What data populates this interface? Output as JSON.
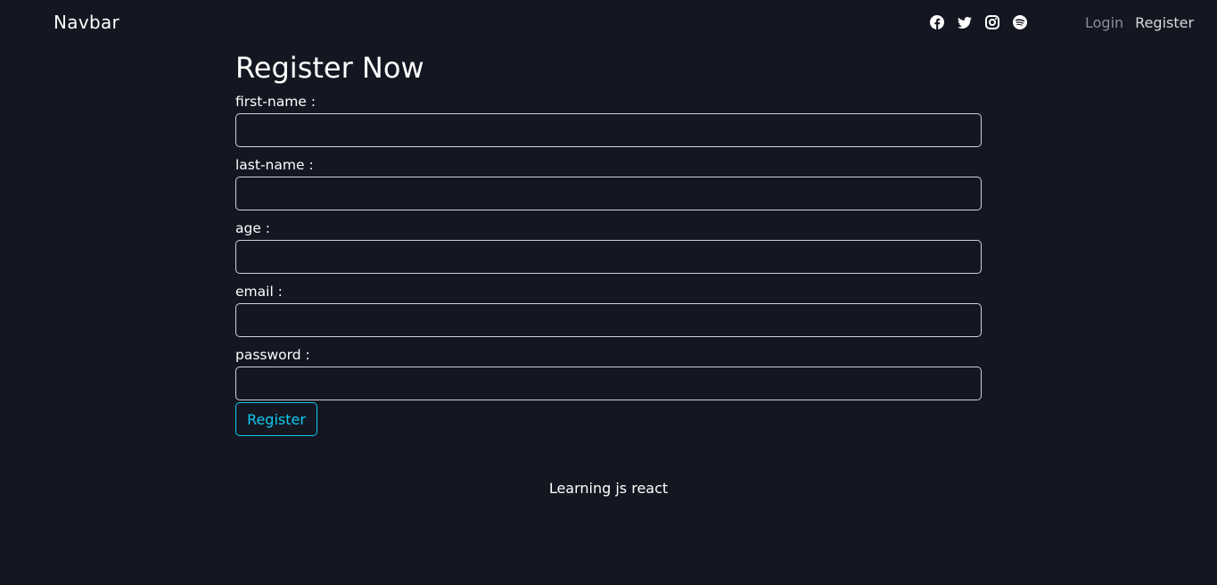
{
  "navbar": {
    "brand": "Navbar",
    "social_icons": [
      "facebook-icon",
      "twitter-icon",
      "instagram-icon",
      "spotify-icon"
    ],
    "links": {
      "login": "Login",
      "register": "Register"
    }
  },
  "form": {
    "title": "Register Now",
    "fields": [
      {
        "label": "first-name :",
        "value": ""
      },
      {
        "label": "last-name :",
        "value": ""
      },
      {
        "label": "age :",
        "value": ""
      },
      {
        "label": "email :",
        "value": ""
      },
      {
        "label": "password :",
        "value": ""
      }
    ],
    "submit_label": "Register"
  },
  "footer": {
    "text": "Learning js react"
  },
  "colors": {
    "background": "#141721",
    "accent": "#0dcaf0",
    "text": "#ffffff",
    "muted_link": "#8b8e96"
  }
}
